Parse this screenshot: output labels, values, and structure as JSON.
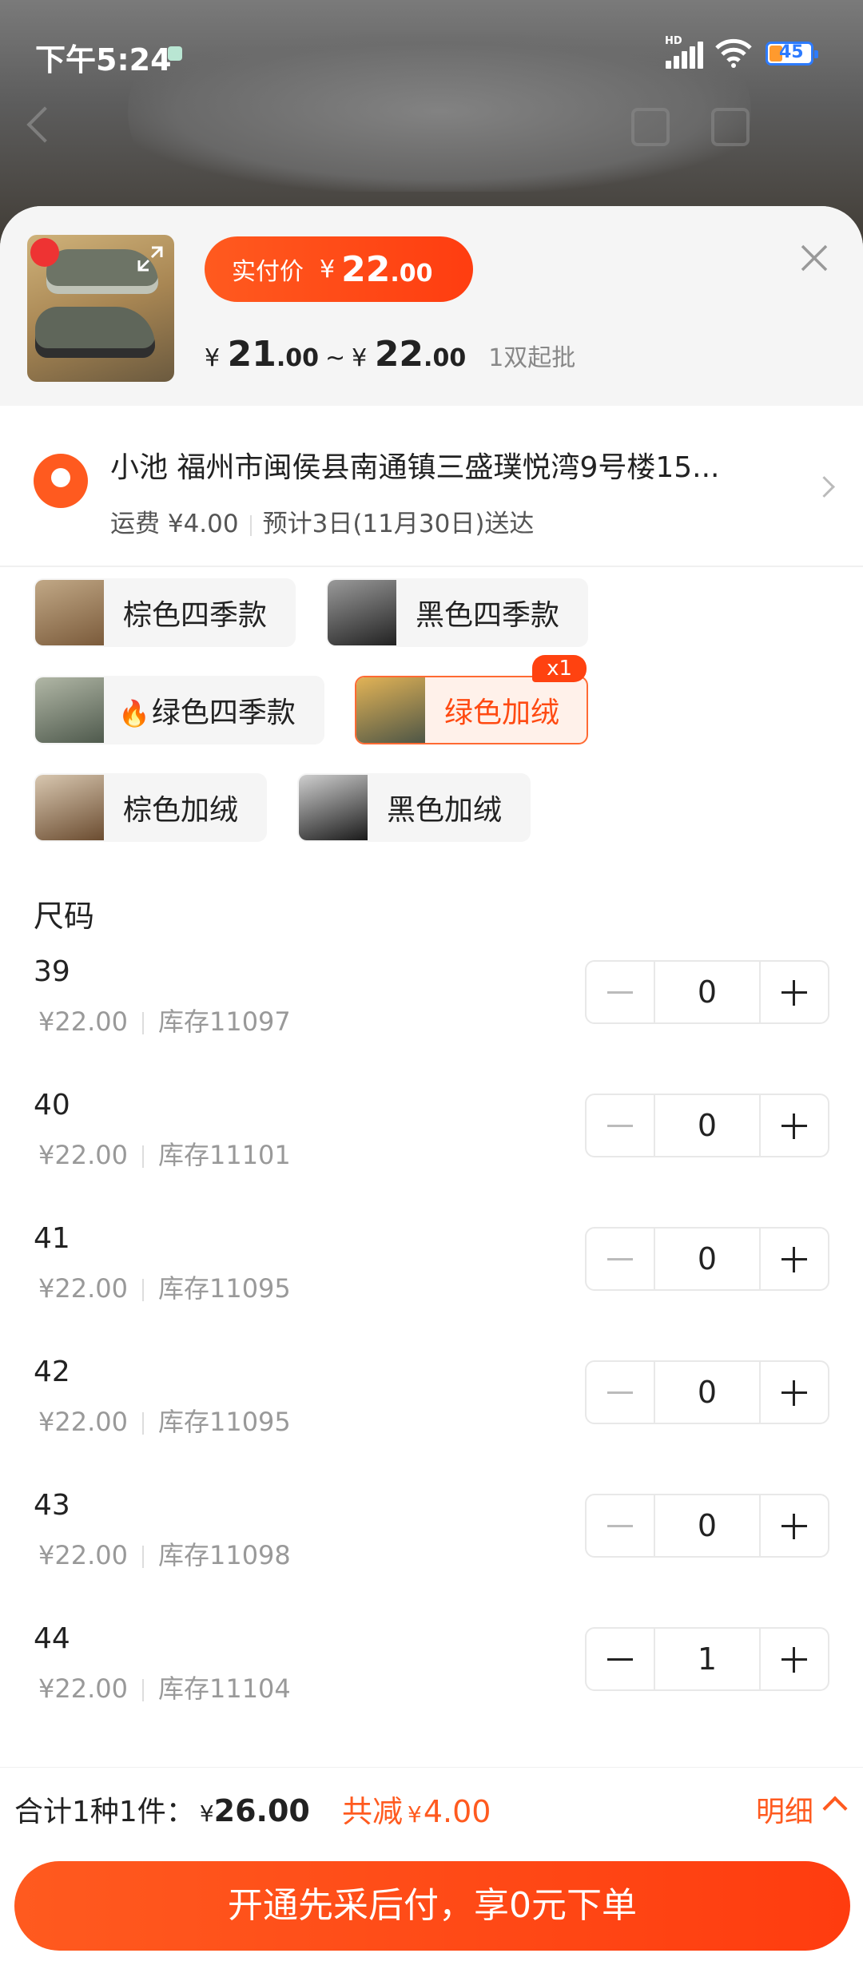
{
  "status_bar": {
    "time": "下午5:24",
    "hd": "HD",
    "battery": "45"
  },
  "product": {
    "actual_price_label": "实付价",
    "currency": "¥",
    "actual_price_int": "22",
    "actual_price_dec": ".00",
    "price_min_int": "21",
    "price_min_dec": ".00",
    "range_sep": "~",
    "price_max_int": "22",
    "price_max_dec": ".00",
    "min_order": "1双起批"
  },
  "address": {
    "line": "小池 福州市闽侯县南通镇三盛璞悦湾9号楼15...",
    "shipping": "运费 ¥4.00",
    "eta": "预计3日(11月30日)送达"
  },
  "colors": [
    {
      "label": "棕色四季款",
      "selected": false
    },
    {
      "label": "黑色四季款",
      "selected": false
    },
    {
      "label": "绿色四季款",
      "selected": false,
      "hot": true
    },
    {
      "label": "绿色加绒",
      "selected": true,
      "badge": "x1"
    },
    {
      "label": "棕色加绒",
      "selected": false
    },
    {
      "label": "黑色加绒",
      "selected": false
    }
  ],
  "sizes": {
    "title": "尺码",
    "stock_prefix": "库存",
    "rows": [
      {
        "size": "39",
        "price": "¥22.00",
        "stock": "库存11097",
        "qty": "0"
      },
      {
        "size": "40",
        "price": "¥22.00",
        "stock": "库存11101",
        "qty": "0"
      },
      {
        "size": "41",
        "price": "¥22.00",
        "stock": "库存11095",
        "qty": "0"
      },
      {
        "size": "42",
        "price": "¥22.00",
        "stock": "库存11095",
        "qty": "0"
      },
      {
        "size": "43",
        "price": "¥22.00",
        "stock": "库存11098",
        "qty": "0"
      },
      {
        "size": "44",
        "price": "¥22.00",
        "stock": "库存11104",
        "qty": "1"
      }
    ]
  },
  "footer": {
    "summary": "合计1种1件：",
    "currency": "¥",
    "total": "26.00",
    "save_label": "共减",
    "save_amount": "4.00",
    "detail": "明细",
    "cta": "开通先采后付，享0元下单"
  },
  "colors_theme": {
    "accent": "#ff5a1f",
    "selected_bg": "#fff1ea"
  }
}
